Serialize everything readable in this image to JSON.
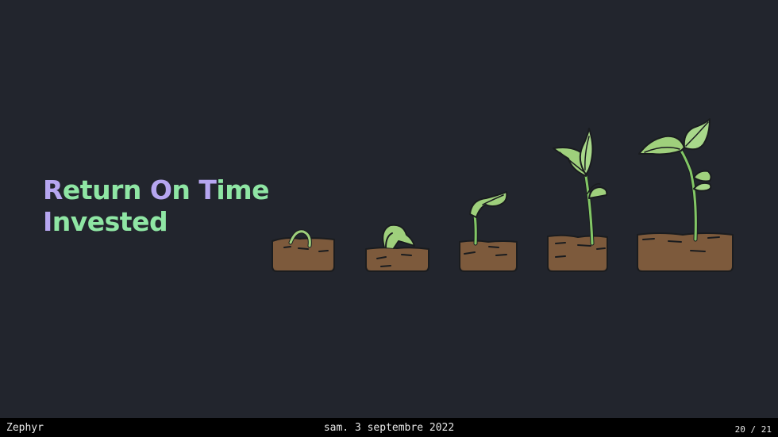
{
  "slide": {
    "title_line1_first": "R",
    "title_line1_rest": "eturn ",
    "title_line1_second": "O",
    "title_line1_middle": "n ",
    "title_line1_third": "T",
    "title_line1_end": "ime",
    "title_line2_first": "I",
    "title_line2_rest": "nvested",
    "illustration": "plant-growth-stages",
    "colors": {
      "background": "#22252d",
      "title_green": "#8fe6a4",
      "title_purple": "#b6a6f0",
      "soil": "#7d5a3c",
      "leaf": "#9fd07c",
      "stem": "#82c766"
    }
  },
  "footer": {
    "author": "Zephyr",
    "date": "sam. 3 septembre 2022",
    "page": "20 / 21"
  }
}
